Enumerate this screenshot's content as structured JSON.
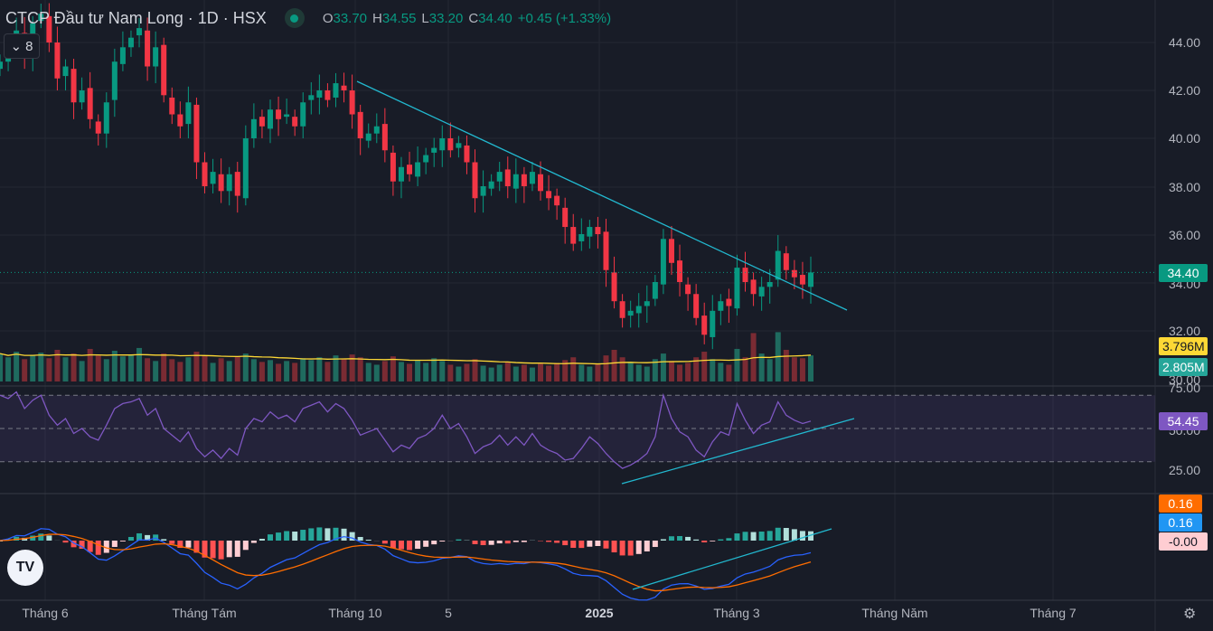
{
  "header": {
    "title": "CTCP Đầu tư Nam Long · 1D · HSX",
    "o_label": "O",
    "o": "33.70",
    "h_label": "H",
    "h": "34.55",
    "l_label": "L",
    "l": "33.20",
    "c_label": "C",
    "c": "34.40",
    "change": "+0.45 (+1.33%)"
  },
  "collapse": {
    "count": "8"
  },
  "price_axis": [
    "44.00",
    "42.00",
    "40.00",
    "38.00",
    "36.00",
    "34.00",
    "32.00",
    "30.00"
  ],
  "rsi_axis": [
    "75.00",
    "50.00",
    "25.00"
  ],
  "tags": {
    "price": "34.40",
    "vol_ma": "3.796M",
    "volume": "2.805M",
    "rsi": "54.45",
    "macd_signal": "0.16",
    "macd": "0.16",
    "hist": "-0.00"
  },
  "time_axis": [
    "Tháng 6",
    "Tháng Tám",
    "Tháng 10",
    "5",
    "2025",
    "Tháng 3",
    "Tháng Năm",
    "Tháng 7"
  ],
  "colors": {
    "up": "#089981",
    "down": "#f23645",
    "trend": "#22b8cf",
    "rsi": "#7e57c2",
    "vol_ma": "#fdd835",
    "macd": "#2962ff",
    "signal": "#ff6d00"
  },
  "chart_data": {
    "type": "candlestick",
    "symbol": "NLG",
    "interval": "1D",
    "price_range": [
      30,
      45.5
    ],
    "close": [
      43.2,
      43.8,
      44.5,
      43.5,
      44.8,
      45.2,
      44.0,
      42.5,
      43.0,
      41.5,
      42.0,
      40.8,
      40.2,
      41.5,
      43.2,
      43.8,
      44.2,
      44.6,
      43.0,
      43.8,
      41.8,
      41.0,
      40.5,
      41.5,
      39.0,
      38.0,
      38.6,
      37.8,
      38.5,
      37.6,
      40.0,
      40.8,
      40.5,
      41.2,
      40.8,
      41.0,
      40.5,
      41.5,
      41.8,
      42.0,
      41.6,
      42.3,
      42.0,
      41.0,
      40.0,
      40.2,
      40.5,
      39.5,
      38.2,
      38.8,
      38.5,
      39.0,
      39.3,
      39.6,
      40.0,
      39.5,
      39.8,
      39.0,
      37.5,
      38.0,
      38.2,
      38.6,
      38.0,
      38.5,
      38.0,
      38.6,
      37.8,
      37.5,
      37.2,
      36.3,
      35.6,
      36.0,
      36.3,
      36.0,
      34.5,
      33.2,
      32.5,
      32.8,
      33.0,
      33.2,
      34.0,
      35.8,
      34.8,
      34.0,
      33.5,
      32.5,
      31.8,
      32.8,
      33.2,
      33.0,
      34.6,
      34.0,
      33.5,
      33.8,
      34.0,
      35.3,
      34.5,
      34.2,
      33.9,
      34.4
    ],
    "volume_m": [
      3.0,
      2.6,
      3.2,
      2.4,
      2.8,
      3.1,
      2.5,
      3.4,
      2.6,
      3.0,
      2.2,
      3.5,
      2.8,
      2.4,
      3.3,
      2.7,
      2.9,
      3.6,
      2.5,
      2.2,
      3.0,
      2.4,
      2.1,
      2.6,
      3.2,
      2.8,
      2.0,
      2.5,
      2.2,
      2.7,
      3.0,
      2.4,
      2.1,
      2.3,
      1.9,
      2.2,
      2.0,
      2.5,
      2.3,
      2.6,
      2.1,
      2.8,
      2.4,
      2.9,
      2.6,
      2.0,
      1.8,
      2.2,
      2.7,
      2.1,
      1.9,
      2.3,
      2.0,
      2.5,
      2.2,
      1.8,
      1.6,
      1.9,
      2.4,
      1.7,
      1.5,
      1.8,
      2.1,
      1.6,
      1.8,
      1.5,
      1.9,
      1.7,
      2.0,
      2.3,
      2.6,
      1.8,
      1.6,
      1.9,
      2.8,
      3.4,
      2.6,
      2.1,
      1.8,
      1.6,
      2.4,
      3.0,
      2.2,
      1.8,
      2.0,
      2.6,
      3.2,
      2.4,
      2.0,
      1.8,
      3.5,
      2.6,
      5.2,
      3.0,
      2.4,
      5.3,
      3.4,
      2.6,
      2.5,
      2.8
    ],
    "rsi": [
      70,
      68,
      72,
      62,
      67,
      70,
      58,
      52,
      56,
      47,
      50,
      45,
      43,
      52,
      62,
      65,
      66,
      68,
      58,
      62,
      50,
      46,
      42,
      48,
      38,
      33,
      37,
      32,
      38,
      34,
      50,
      56,
      54,
      60,
      56,
      58,
      54,
      62,
      64,
      66,
      60,
      65,
      62,
      55,
      46,
      48,
      50,
      43,
      36,
      40,
      38,
      44,
      46,
      50,
      58,
      50,
      53,
      45,
      35,
      39,
      41,
      46,
      40,
      45,
      40,
      47,
      40,
      37,
      35,
      31,
      32,
      38,
      45,
      41,
      35,
      30,
      26,
      28,
      31,
      35,
      45,
      70,
      56,
      48,
      45,
      37,
      33,
      42,
      48,
      46,
      65,
      55,
      47,
      52,
      54,
      66,
      58,
      55,
      53,
      54.45
    ],
    "rsi_bands": [
      70,
      50,
      30
    ]
  }
}
